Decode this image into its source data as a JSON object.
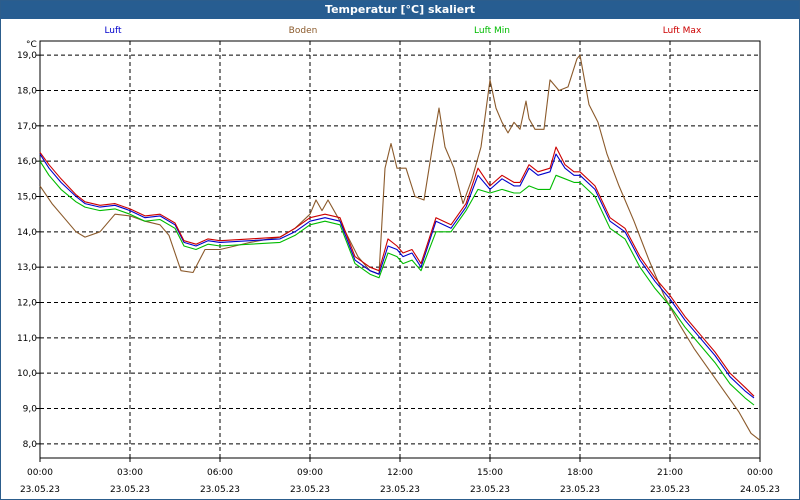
{
  "window": {
    "title": "Temperatur [°C] skaliert"
  },
  "chart_data": {
    "type": "line",
    "title": "Temperatur [°C] skaliert",
    "ylabel": "°C",
    "ylim": [
      7.6,
      19.4
    ],
    "yticks": [
      "8,0",
      "9,0",
      "10,0",
      "11,0",
      "12,0",
      "13,0",
      "14,0",
      "15,0",
      "16,0",
      "17,0",
      "18,0",
      "19,0"
    ],
    "xlim": [
      0,
      24
    ],
    "xticks": [
      {
        "time": "00:00",
        "date": "23.05.23"
      },
      {
        "time": "03:00",
        "date": "23.05.23"
      },
      {
        "time": "06:00",
        "date": "23.05.23"
      },
      {
        "time": "09:00",
        "date": "23.05.23"
      },
      {
        "time": "12:00",
        "date": "23.05.23"
      },
      {
        "time": "15:00",
        "date": "23.05.23"
      },
      {
        "time": "18:00",
        "date": "23.05.23"
      },
      {
        "time": "21:00",
        "date": "23.05.23"
      },
      {
        "time": "00:00",
        "date": "24.05.23"
      }
    ],
    "grid": true,
    "legend_position": "top",
    "series": [
      {
        "name": "Luft",
        "color": "#0000cc",
        "points": [
          [
            0,
            16.2
          ],
          [
            0.3,
            15.8
          ],
          [
            0.7,
            15.4
          ],
          [
            1.2,
            15.0
          ],
          [
            1.5,
            14.8
          ],
          [
            2,
            14.7
          ],
          [
            2.5,
            14.75
          ],
          [
            3,
            14.6
          ],
          [
            3.5,
            14.4
          ],
          [
            4,
            14.45
          ],
          [
            4.5,
            14.2
          ],
          [
            4.8,
            13.7
          ],
          [
            5.2,
            13.6
          ],
          [
            5.6,
            13.75
          ],
          [
            6,
            13.7
          ],
          [
            7,
            13.75
          ],
          [
            8,
            13.8
          ],
          [
            8.5,
            14.0
          ],
          [
            9,
            14.3
          ],
          [
            9.5,
            14.4
          ],
          [
            10,
            14.3
          ],
          [
            10.5,
            13.2
          ],
          [
            11,
            12.9
          ],
          [
            11.3,
            12.8
          ],
          [
            11.6,
            13.6
          ],
          [
            11.9,
            13.5
          ],
          [
            12.1,
            13.3
          ],
          [
            12.4,
            13.4
          ],
          [
            12.7,
            13.0
          ],
          [
            13.2,
            14.3
          ],
          [
            13.7,
            14.1
          ],
          [
            14.2,
            14.7
          ],
          [
            14.6,
            15.6
          ],
          [
            15,
            15.2
          ],
          [
            15.4,
            15.5
          ],
          [
            15.8,
            15.3
          ],
          [
            16,
            15.3
          ],
          [
            16.3,
            15.8
          ],
          [
            16.6,
            15.6
          ],
          [
            17,
            15.7
          ],
          [
            17.2,
            16.2
          ],
          [
            17.5,
            15.8
          ],
          [
            17.8,
            15.6
          ],
          [
            18,
            15.6
          ],
          [
            18.5,
            15.2
          ],
          [
            19,
            14.3
          ],
          [
            19.5,
            14.0
          ],
          [
            20,
            13.2
          ],
          [
            20.5,
            12.6
          ],
          [
            21,
            12.1
          ],
          [
            21.5,
            11.5
          ],
          [
            22,
            11.0
          ],
          [
            22.5,
            10.5
          ],
          [
            23,
            9.9
          ],
          [
            23.5,
            9.5
          ],
          [
            23.8,
            9.3
          ]
        ]
      },
      {
        "name": "Boden",
        "color": "#8b5a2b",
        "points": [
          [
            0,
            15.3
          ],
          [
            0.4,
            14.8
          ],
          [
            0.8,
            14.4
          ],
          [
            1.2,
            14.0
          ],
          [
            1.5,
            13.85
          ],
          [
            2,
            14.0
          ],
          [
            2.5,
            14.5
          ],
          [
            3,
            14.45
          ],
          [
            3.5,
            14.3
          ],
          [
            4,
            14.2
          ],
          [
            4.3,
            13.9
          ],
          [
            4.7,
            12.9
          ],
          [
            5.1,
            12.85
          ],
          [
            5.5,
            13.5
          ],
          [
            6,
            13.5
          ],
          [
            6.5,
            13.6
          ],
          [
            7,
            13.7
          ],
          [
            8,
            13.85
          ],
          [
            8.5,
            14.1
          ],
          [
            9,
            14.5
          ],
          [
            9.2,
            14.9
          ],
          [
            9.4,
            14.6
          ],
          [
            9.6,
            14.9
          ],
          [
            10,
            14.3
          ],
          [
            10.3,
            13.8
          ],
          [
            10.6,
            13.3
          ],
          [
            11,
            12.9
          ],
          [
            11.3,
            12.8
          ],
          [
            11.5,
            15.8
          ],
          [
            11.7,
            16.5
          ],
          [
            11.9,
            15.8
          ],
          [
            12.2,
            15.8
          ],
          [
            12.5,
            15.0
          ],
          [
            12.8,
            14.9
          ],
          [
            13.1,
            16.5
          ],
          [
            13.3,
            17.5
          ],
          [
            13.5,
            16.4
          ],
          [
            13.8,
            15.8
          ],
          [
            14.1,
            14.8
          ],
          [
            14.4,
            15.5
          ],
          [
            14.7,
            16.4
          ],
          [
            15,
            18.3
          ],
          [
            15.2,
            17.5
          ],
          [
            15.4,
            17.1
          ],
          [
            15.6,
            16.8
          ],
          [
            15.8,
            17.1
          ],
          [
            16,
            16.9
          ],
          [
            16.2,
            17.7
          ],
          [
            16.3,
            17.2
          ],
          [
            16.5,
            16.9
          ],
          [
            16.8,
            16.9
          ],
          [
            17,
            18.3
          ],
          [
            17.3,
            18.0
          ],
          [
            17.6,
            18.1
          ],
          [
            17.9,
            18.9
          ],
          [
            18,
            19.0
          ],
          [
            18.3,
            17.6
          ],
          [
            18.6,
            17.1
          ],
          [
            18.9,
            16.2
          ],
          [
            19.3,
            15.3
          ],
          [
            19.8,
            14.3
          ],
          [
            20.3,
            13.2
          ],
          [
            20.8,
            12.2
          ],
          [
            21.3,
            11.4
          ],
          [
            21.8,
            10.7
          ],
          [
            22.3,
            10.1
          ],
          [
            22.8,
            9.5
          ],
          [
            23.3,
            8.9
          ],
          [
            23.7,
            8.3
          ],
          [
            24,
            8.1
          ]
        ]
      },
      {
        "name": "Luft Min",
        "color": "#00bb00",
        "points": [
          [
            0,
            16.0
          ],
          [
            0.3,
            15.6
          ],
          [
            0.7,
            15.2
          ],
          [
            1.2,
            14.85
          ],
          [
            1.5,
            14.7
          ],
          [
            2,
            14.6
          ],
          [
            2.5,
            14.65
          ],
          [
            3,
            14.5
          ],
          [
            3.5,
            14.3
          ],
          [
            4,
            14.35
          ],
          [
            4.5,
            14.1
          ],
          [
            4.8,
            13.6
          ],
          [
            5.2,
            13.5
          ],
          [
            5.6,
            13.65
          ],
          [
            6,
            13.6
          ],
          [
            7,
            13.65
          ],
          [
            8,
            13.7
          ],
          [
            8.5,
            13.9
          ],
          [
            9,
            14.2
          ],
          [
            9.5,
            14.3
          ],
          [
            10,
            14.2
          ],
          [
            10.5,
            13.1
          ],
          [
            11,
            12.8
          ],
          [
            11.3,
            12.7
          ],
          [
            11.6,
            13.4
          ],
          [
            11.9,
            13.3
          ],
          [
            12.1,
            13.1
          ],
          [
            12.4,
            13.2
          ],
          [
            12.7,
            12.9
          ],
          [
            13.2,
            14.0
          ],
          [
            13.7,
            14.0
          ],
          [
            14.2,
            14.6
          ],
          [
            14.6,
            15.2
          ],
          [
            15,
            15.1
          ],
          [
            15.4,
            15.2
          ],
          [
            15.8,
            15.1
          ],
          [
            16,
            15.1
          ],
          [
            16.3,
            15.3
          ],
          [
            16.6,
            15.2
          ],
          [
            17,
            15.2
          ],
          [
            17.2,
            15.6
          ],
          [
            17.5,
            15.5
          ],
          [
            17.8,
            15.4
          ],
          [
            18,
            15.4
          ],
          [
            18.5,
            15.0
          ],
          [
            19,
            14.1
          ],
          [
            19.5,
            13.8
          ],
          [
            20,
            13.0
          ],
          [
            20.5,
            12.4
          ],
          [
            21,
            11.9
          ],
          [
            21.5,
            11.3
          ],
          [
            22,
            10.8
          ],
          [
            22.5,
            10.3
          ],
          [
            23,
            9.7
          ],
          [
            23.5,
            9.3
          ],
          [
            23.8,
            9.1
          ]
        ]
      },
      {
        "name": "Luft Max",
        "color": "#cc0000",
        "points": [
          [
            0,
            16.25
          ],
          [
            0.3,
            15.9
          ],
          [
            0.7,
            15.5
          ],
          [
            1.2,
            15.05
          ],
          [
            1.5,
            14.85
          ],
          [
            2,
            14.75
          ],
          [
            2.5,
            14.8
          ],
          [
            3,
            14.65
          ],
          [
            3.5,
            14.45
          ],
          [
            4,
            14.5
          ],
          [
            4.5,
            14.25
          ],
          [
            4.8,
            13.75
          ],
          [
            5.2,
            13.65
          ],
          [
            5.6,
            13.8
          ],
          [
            6,
            13.75
          ],
          [
            7,
            13.8
          ],
          [
            8,
            13.85
          ],
          [
            8.5,
            14.1
          ],
          [
            9,
            14.4
          ],
          [
            9.5,
            14.5
          ],
          [
            10,
            14.4
          ],
          [
            10.5,
            13.3
          ],
          [
            11,
            13.0
          ],
          [
            11.3,
            12.9
          ],
          [
            11.6,
            13.8
          ],
          [
            11.9,
            13.6
          ],
          [
            12.1,
            13.4
          ],
          [
            12.4,
            13.5
          ],
          [
            12.7,
            13.1
          ],
          [
            13.2,
            14.4
          ],
          [
            13.7,
            14.2
          ],
          [
            14.2,
            14.8
          ],
          [
            14.6,
            15.8
          ],
          [
            15,
            15.3
          ],
          [
            15.4,
            15.6
          ],
          [
            15.8,
            15.4
          ],
          [
            16,
            15.4
          ],
          [
            16.3,
            15.9
          ],
          [
            16.6,
            15.7
          ],
          [
            17,
            15.8
          ],
          [
            17.2,
            16.4
          ],
          [
            17.5,
            15.9
          ],
          [
            17.8,
            15.7
          ],
          [
            18,
            15.7
          ],
          [
            18.5,
            15.3
          ],
          [
            19,
            14.4
          ],
          [
            19.5,
            14.1
          ],
          [
            20,
            13.3
          ],
          [
            20.5,
            12.7
          ],
          [
            21,
            12.2
          ],
          [
            21.5,
            11.6
          ],
          [
            22,
            11.1
          ],
          [
            22.5,
            10.6
          ],
          [
            23,
            10.0
          ],
          [
            23.5,
            9.6
          ],
          [
            23.8,
            9.35
          ]
        ]
      }
    ]
  }
}
